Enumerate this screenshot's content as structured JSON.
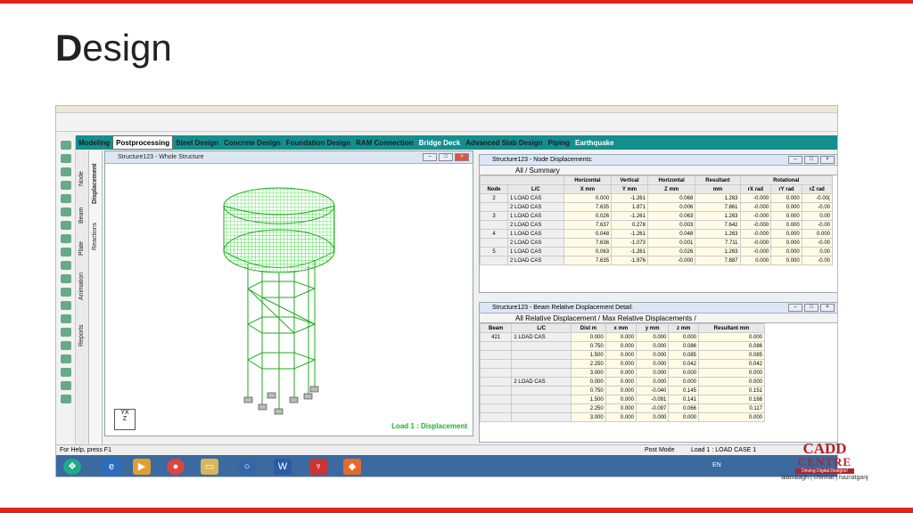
{
  "slide": {
    "title_bold": "D",
    "title_rest": "esign"
  },
  "tabs": [
    "Modeling",
    "Postprocessing",
    "Steel Design",
    "Concrete Design",
    "Foundation Design",
    "RAM Connection",
    "Bridge Deck",
    "Advanced Slab Design",
    "Piping",
    "Earthquake"
  ],
  "vtabs1": [
    "Node",
    "Beam",
    "Plate",
    "Animation",
    "Reports"
  ],
  "vtabs2": [
    "Displacement",
    "Reactions"
  ],
  "viewport": {
    "title": "Structure123 - Whole Structure",
    "load_label": "Load 1 : Displacement",
    "axis_y": "Y",
    "axis_x": "X",
    "axis_z": "Z"
  },
  "node_grid": {
    "title": "Structure123 - Node Displacements:",
    "tabs": "All / Summary",
    "group_headers": [
      "Horizontal",
      "Vertical",
      "Horizontal",
      "Resultant",
      "Rotational"
    ],
    "headers": [
      "Node",
      "L/C",
      "X mm",
      "Y mm",
      "Z mm",
      "mm",
      "rX rad",
      "rY rad",
      "rZ rad"
    ],
    "rows": [
      [
        "2",
        "1 LOAD CAS",
        "0.000",
        "-1.261",
        "0.068",
        "1.263",
        "-0.000",
        "0.000",
        "-0.00("
      ],
      [
        "",
        "2 LOAD CAS",
        "7.635",
        "1.871",
        "0.006",
        "7.861",
        "-0.000",
        "0.000",
        "-0.00"
      ],
      [
        "3",
        "1 LOAD CAS",
        "0.026",
        "-1.261",
        "0.063",
        "1.263",
        "-0.000",
        "0.000",
        "0.00"
      ],
      [
        "",
        "2 LOAD CAS",
        "7.637",
        "0.278",
        "0.003",
        "7.642",
        "-0.000",
        "0.000",
        "-0.00"
      ],
      [
        "4",
        "1 LOAD CAS",
        "0.048",
        "-1.261",
        "0.048",
        "1.263",
        "-0.000",
        "0.000",
        "0.000"
      ],
      [
        "",
        "2 LOAD CAS",
        "7.636",
        "-1.073",
        "0.001",
        "7.711",
        "-0.000",
        "0.000",
        "-0.00"
      ],
      [
        "5",
        "1 LOAD CAS",
        "0.063",
        "-1.261",
        "0.026",
        "1.263",
        "-0.000",
        "0.000",
        "0.00"
      ],
      [
        "",
        "2 LOAD CAS",
        "7.635",
        "-1.976",
        "-0.000",
        "7.887",
        "0.000",
        "0.000",
        "-0.00"
      ]
    ]
  },
  "beam_grid": {
    "title": "Structure123 - Beam Relative Displacement Detail:",
    "tabs": "All Relative Displacement / Max Relative Displacements /",
    "headers": [
      "Beam",
      "L/C",
      "Dist m",
      "x mm",
      "y mm",
      "z mm",
      "Resultant mm"
    ],
    "rows": [
      [
        "421",
        "1 LOAD CAS",
        "0.000",
        "0.000",
        "0.000",
        "0.000",
        "0.000"
      ],
      [
        "",
        "",
        "0.750",
        "0.000",
        "0.000",
        "0.086",
        "0.086"
      ],
      [
        "",
        "",
        "1.500",
        "0.000",
        "0.000",
        "0.085",
        "0.085"
      ],
      [
        "",
        "",
        "2.250",
        "0.000",
        "0.000",
        "0.042",
        "0.042"
      ],
      [
        "",
        "",
        "3.000",
        "0.000",
        "0.000",
        "0.000",
        "0.000"
      ],
      [
        "",
        "2 LOAD CAS",
        "0.000",
        "0.000",
        "0.000",
        "0.000",
        "0.000"
      ],
      [
        "",
        "",
        "0.750",
        "0.000",
        "-0.040",
        "0.145",
        "0.151"
      ],
      [
        "",
        "",
        "1.500",
        "0.000",
        "-0.091",
        "0.141",
        "0.168"
      ],
      [
        "",
        "",
        "2.250",
        "0.000",
        "-0.097",
        "0.066",
        "0.117"
      ],
      [
        "",
        "",
        "3.000",
        "0.000",
        "0.000",
        "0.000",
        "0.000"
      ]
    ]
  },
  "status": {
    "left": "For Help, press F1",
    "mode": "Post Mode",
    "load": "Load 1 : LOAD CASE 1"
  },
  "taskbar": {
    "lang": "EN"
  },
  "logo": {
    "line1": "CADD",
    "line2": "CENTRE",
    "tagline": "Driving Digital Designs!",
    "locations": "alambagh | chinhat | hazratganj"
  },
  "colors": {
    "accent_red": "#e2231a",
    "tab_bar": "#138f8f",
    "mesh_green": "#33dd33"
  }
}
